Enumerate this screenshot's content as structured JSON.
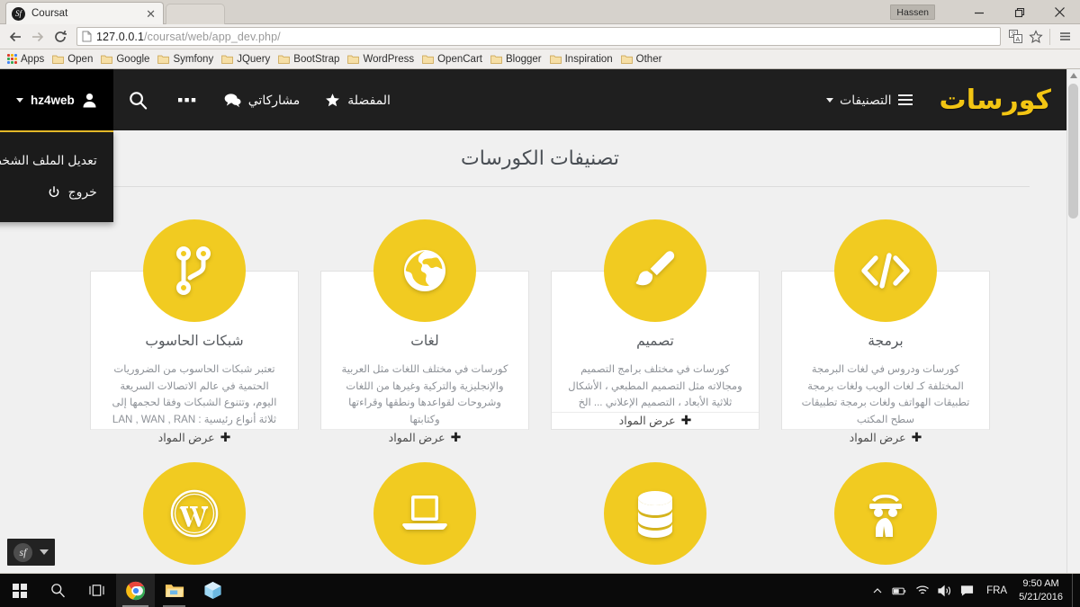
{
  "browser": {
    "tab_title": "Coursat",
    "tab_favicon": "symfony-icon",
    "close_tab_label": "✕",
    "profile_name": "Hassen",
    "url_host": "127.0.0.1",
    "url_path": "/coursat/web/app_dev.php/",
    "bookmarks": [
      {
        "label": "Apps",
        "icon": "apps-grid-icon"
      },
      {
        "label": "Open",
        "icon": "folder-icon"
      },
      {
        "label": "Google",
        "icon": "folder-icon"
      },
      {
        "label": "Symfony",
        "icon": "folder-icon"
      },
      {
        "label": "JQuery",
        "icon": "folder-icon"
      },
      {
        "label": "BootStrap",
        "icon": "folder-icon"
      },
      {
        "label": "WordPress",
        "icon": "folder-icon"
      },
      {
        "label": "OpenCart",
        "icon": "folder-icon"
      },
      {
        "label": "Blogger",
        "icon": "folder-icon"
      },
      {
        "label": "Inspiration",
        "icon": "folder-icon"
      },
      {
        "label": "Other",
        "icon": "folder-icon"
      }
    ]
  },
  "site": {
    "brand": "كورسات",
    "categories_label": "التصنيفات",
    "nav": [
      {
        "label": "المفضلة",
        "icon": "star-icon"
      },
      {
        "label": "مشاركاتي",
        "icon": "comments-icon"
      }
    ],
    "more_label": "•••",
    "search_label": "search-icon",
    "user": {
      "name": "hz4web",
      "menu": [
        {
          "label": "تعديل الملف الشخصي",
          "icon": "gear-icon"
        },
        {
          "label": "خروج",
          "icon": "power-icon"
        }
      ]
    },
    "accent_color": "#f1cb21",
    "header_bg": "#1f1f1f"
  },
  "page": {
    "title": "تصنيفات الكورسات",
    "view_materials_label": "عرض المواد",
    "plus_symbol": "✚",
    "categories": [
      {
        "title": "برمجة",
        "icon": "code-icon",
        "desc": "كورسات ودروس في لغات البرمجة المختلفة كـ لغات الويب ولغات برمجة تطبيقات الهواتف ولغات برمجة تطبيقات سطح المكتب"
      },
      {
        "title": "تصميم",
        "icon": "paintbrush-icon",
        "desc": "كورسات في مختلف برامج التصميم ومجالاته مثل التصميم المطبعي ، الأشكال ثلاثية الأبعاد ، التصميم الإعلاني ... الخ"
      },
      {
        "title": "لغات",
        "icon": "globe-icon",
        "desc": "كورسات في مختلف اللغات مثل العربية والإنجليزية والتركية وغيرها من اللغات وشروحات لقواعدها ونطقها وقراءتها وكتابتها"
      },
      {
        "title": "شبكات الحاسوب",
        "icon": "sitemap-icon",
        "desc": "تعتبر شبكات الحاسوب من الضروريات الحتمية في عالم الاتصالات السريعة اليوم، وتتنوع الشبكات وفقا لحجمها إلى ثلاثة أنواع رئيسية : LAN , WAN , RAN"
      }
    ],
    "categories_row2": [
      {
        "icon": "spy-icon"
      },
      {
        "icon": "database-icon"
      },
      {
        "icon": "laptop-icon"
      },
      {
        "icon": "wordpress-icon"
      }
    ]
  },
  "taskbar": {
    "buttons": [
      {
        "name": "start-button",
        "icon": "windows-logo-icon"
      },
      {
        "name": "search-button",
        "icon": "search-icon"
      },
      {
        "name": "task-view-button",
        "icon": "task-view-icon"
      },
      {
        "name": "chrome-button",
        "icon": "chrome-icon"
      },
      {
        "name": "file-explorer-button",
        "icon": "folder-icon"
      },
      {
        "name": "3d-builder-button",
        "icon": "cube-icon"
      }
    ],
    "language": "FRA",
    "time": "9:50 AM",
    "date": "5/21/2016"
  },
  "symfony_toolbar": {
    "logo": "sf"
  }
}
